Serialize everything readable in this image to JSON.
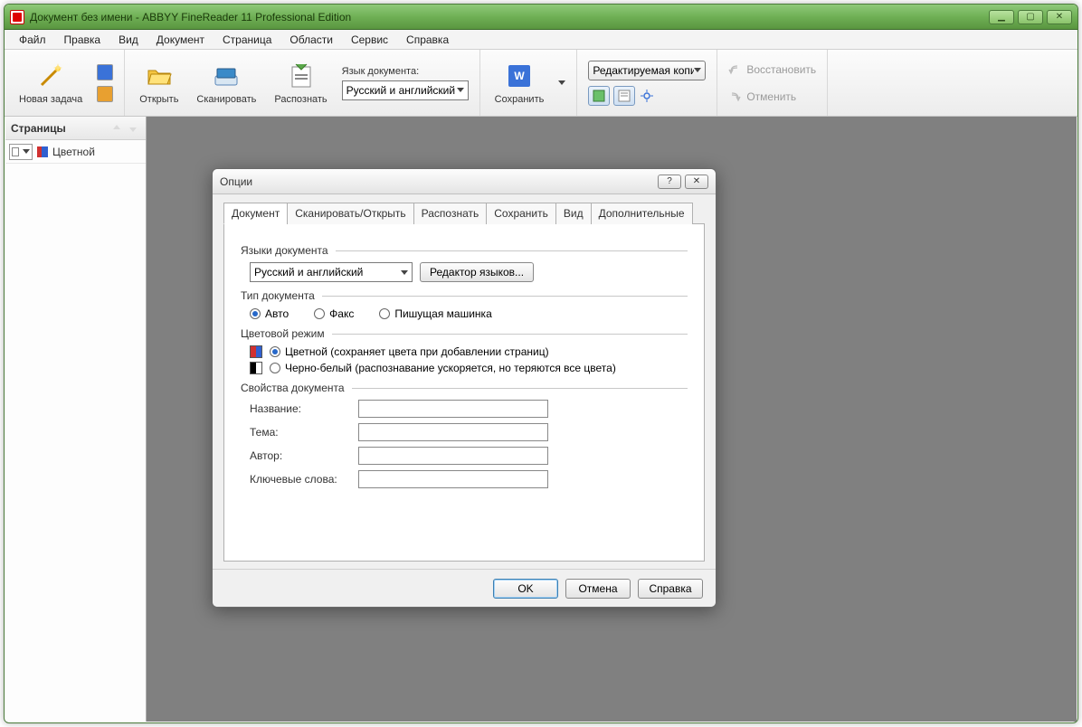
{
  "window": {
    "title": "Документ без имени - ABBYY FineReader 11 Professional Edition"
  },
  "menu": {
    "file": "Файл",
    "edit": "Правка",
    "view": "Вид",
    "document": "Документ",
    "page": "Страница",
    "areas": "Области",
    "service": "Сервис",
    "help": "Справка"
  },
  "toolbar": {
    "new_task": "Новая задача",
    "open": "Открыть",
    "scan": "Сканировать",
    "recognize": "Распознать",
    "lang_label": "Язык документа:",
    "lang_value": "Русский и английский",
    "save": "Сохранить",
    "editable_copy": "Редактируемая копи",
    "restore": "Восстановить",
    "cancel": "Отменить"
  },
  "sidebar": {
    "title": "Страницы",
    "view_mode": "Цветной"
  },
  "dialog": {
    "title": "Опции",
    "tabs": {
      "document": "Документ",
      "scan_open": "Сканировать/Открыть",
      "recognize": "Распознать",
      "save": "Сохранить",
      "view": "Вид",
      "additional": "Дополнительные"
    },
    "group_lang": "Языки документа",
    "lang_value": "Русский и английский",
    "lang_editor_btn": "Редактор языков...",
    "group_type": "Тип документа",
    "type_auto": "Авто",
    "type_fax": "Факс",
    "type_typewriter": "Пишущая машинка",
    "group_color": "Цветовой режим",
    "color_color": "Цветной (сохраняет цвета при добавлении страниц)",
    "color_bw": "Черно-белый (распознавание ускоряется, но теряются все цвета)",
    "group_props": "Свойства документа",
    "prop_title": "Название:",
    "prop_subject": "Тема:",
    "prop_author": "Автор:",
    "prop_keywords": "Ключевые слова:",
    "ok": "OK",
    "cancel": "Отмена",
    "help": "Справка"
  }
}
